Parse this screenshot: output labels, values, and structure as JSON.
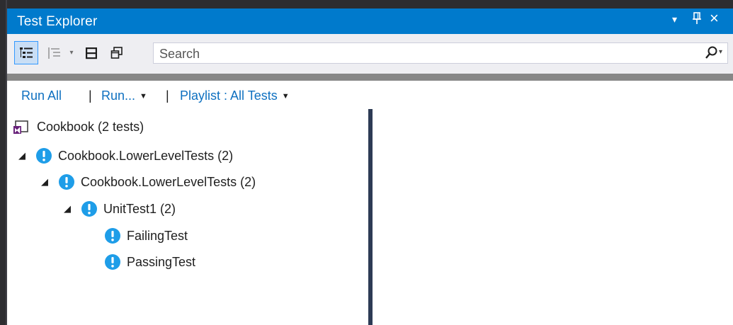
{
  "window": {
    "title": "Test Explorer",
    "controls": {
      "dropdown": "▾",
      "pin": "ᛘ",
      "close": "×"
    }
  },
  "toolbar": {
    "search": {
      "placeholder": "Search",
      "value": ""
    },
    "search_icon": "search-icon",
    "dropdown_glyph": "▾"
  },
  "commands": {
    "run_all": "Run All",
    "separator": "|",
    "run": "Run...",
    "playlist": "Playlist : All Tests",
    "caret": "▼"
  },
  "tree": {
    "project": "Cookbook (2 tests)",
    "nodes": [
      {
        "label": "Cookbook.LowerLevelTests (2)",
        "status": "not-run",
        "expanded": true
      },
      {
        "label": "Cookbook.LowerLevelTests (2)",
        "status": "not-run",
        "expanded": true
      },
      {
        "label": "UnitTest1 (2)",
        "status": "not-run",
        "expanded": true
      },
      {
        "label": "FailingTest",
        "status": "not-run"
      },
      {
        "label": "PassingTest",
        "status": "not-run"
      }
    ],
    "expander_glyph": "◢"
  },
  "colors": {
    "title_bar": "#007acc",
    "link": "#0e70c0",
    "status_icon": "#1e9de8",
    "splitter": "#2d3b55"
  }
}
